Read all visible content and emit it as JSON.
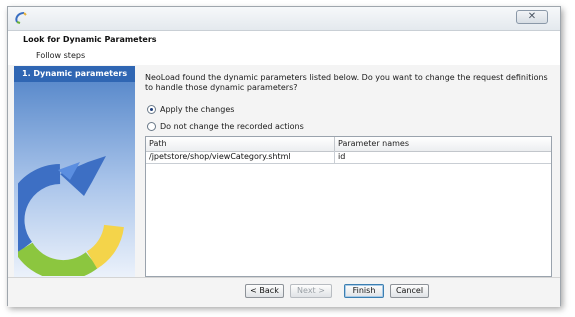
{
  "window": {
    "close_glyph": "✕"
  },
  "header": {
    "title": "Look for Dynamic Parameters",
    "subtitle": "Follow steps"
  },
  "sidebar": {
    "items": [
      {
        "label": "1. Dynamic parameters",
        "selected": true
      }
    ]
  },
  "main": {
    "question": "NeoLoad found the dynamic parameters listed below. Do you want to change the request definitions to handle those dynamic parameters?",
    "options": [
      {
        "label": "Apply the changes",
        "checked": true
      },
      {
        "label": "Do not change the recorded actions",
        "checked": false
      }
    ],
    "table": {
      "columns": [
        "Path",
        "Parameter names"
      ],
      "rows": [
        [
          "/jpetstore/shop/viewCategory.shtml",
          "id"
        ]
      ]
    }
  },
  "footer": {
    "back_label": "< Back",
    "next_label": "Next >",
    "finish_label": "Finish",
    "cancel_label": "Cancel"
  },
  "colors": {
    "sidebar_selected": "#2f66b3",
    "sidebar_gradient_top": "#4f82c7",
    "focus_border": "#3c7fb1"
  },
  "icons": {
    "app": "neoload-app-icon",
    "sidebar_graphic": "circular-arrow-graphic"
  }
}
